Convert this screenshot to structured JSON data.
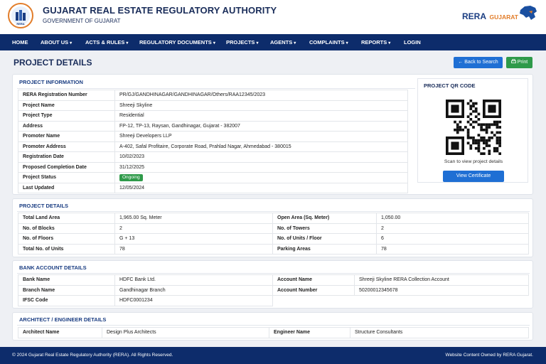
{
  "header": {
    "logo_text": "RERA",
    "title": "GUJARAT REAL ESTATE REGULATORY AUTHORITY",
    "subtitle": "GOVERNMENT OF GUJARAT",
    "brand_main": "RERA",
    "brand_sub": "GUJARAT"
  },
  "nav": {
    "items": [
      {
        "label": "HOME",
        "dropdown": false
      },
      {
        "label": "ABOUT US",
        "dropdown": true
      },
      {
        "label": "ACTS & RULES",
        "dropdown": true
      },
      {
        "label": "REGULATORY DOCUMENTS",
        "dropdown": true
      },
      {
        "label": "PROJECTS",
        "dropdown": true
      },
      {
        "label": "AGENTS",
        "dropdown": true
      },
      {
        "label": "COMPLAINTS",
        "dropdown": true
      },
      {
        "label": "REPORTS",
        "dropdown": true
      },
      {
        "label": "LOGIN",
        "dropdown": false
      }
    ],
    "caret": "▾"
  },
  "page": {
    "title": "PROJECT DETAILS",
    "back_label": "Back to Search",
    "print_label": "Print"
  },
  "project_info": {
    "title": "PROJECT INFORMATION",
    "rows": [
      {
        "label": "RERA Registration Number",
        "value": "PR/GJ/GANDHINAGAR/GANDHINAGAR/Others/RAA12345/2023"
      },
      {
        "label": "Project Name",
        "value": "Shreeji Skyline"
      },
      {
        "label": "Project Type",
        "value": "Residential"
      },
      {
        "label": "Address",
        "value": "FP-12, TP-13, Raysan, Gandhinagar, Gujarat - 382007"
      },
      {
        "label": "Promoter Name",
        "value": "Shreeji Developers LLP"
      },
      {
        "label": "Promoter Address",
        "value": "A-402, Safal Profitaire, Corporate Road, Prahlad Nagar, Ahmedabad - 380015"
      },
      {
        "label": "Registration Date",
        "value": "10/02/2023"
      },
      {
        "label": "Proposed Completion Date",
        "value": "31/12/2025"
      },
      {
        "label": "Project Status",
        "value": "Ongoing"
      },
      {
        "label": "Last Updated",
        "value": "12/05/2024"
      }
    ]
  },
  "qr": {
    "title": "PROJECT QR CODE",
    "caption": "Scan to view project details",
    "button": "View Certificate"
  },
  "project_details": {
    "title": "PROJECT DETAILS",
    "rows": [
      [
        "Total Land Area",
        "1,965.00 Sq. Meter",
        "Open Area (Sq. Meter)",
        "1,050.00"
      ],
      [
        "No. of Blocks",
        "2",
        "No. of Towers",
        "2"
      ],
      [
        "No. of Floors",
        "G + 13",
        "No. of Units / Floor",
        "6"
      ],
      [
        "Total No. of Units",
        "78",
        "Parking Areas",
        "78"
      ]
    ]
  },
  "bank": {
    "title": "BANK ACCOUNT DETAILS",
    "rows": [
      [
        "Bank Name",
        "HDFC Bank Ltd.",
        "Account Name",
        "Shreeji Skyline RERA Collection Account"
      ],
      [
        "Branch Name",
        "Gandhinagar Branch",
        "Account Number",
        "50200012345678"
      ],
      [
        "IFSC Code",
        "HDFC0001234"
      ]
    ]
  },
  "architect": {
    "title": "ARCHITECT / ENGINEER DETAILS",
    "rows": [
      [
        "Architect Name",
        "Design Plus Architects",
        "Engineer Name",
        "Structure Consultants"
      ]
    ]
  },
  "footer": {
    "left": "© 2024 Gujarat Real Estate Regulatory Authority (RERA). All Rights Reserved.",
    "right": "Website Content Owned by RERA Gujarat."
  },
  "colors": {
    "navy": "#0d2c6b",
    "accent_blue": "#1f6fd4",
    "green": "#2f9a4a",
    "orange": "#e27d2a"
  },
  "icons": [
    "rera-logo-icon",
    "gujarat-map-icon",
    "arrow-left-icon",
    "printer-icon",
    "qr-code-icon"
  ]
}
